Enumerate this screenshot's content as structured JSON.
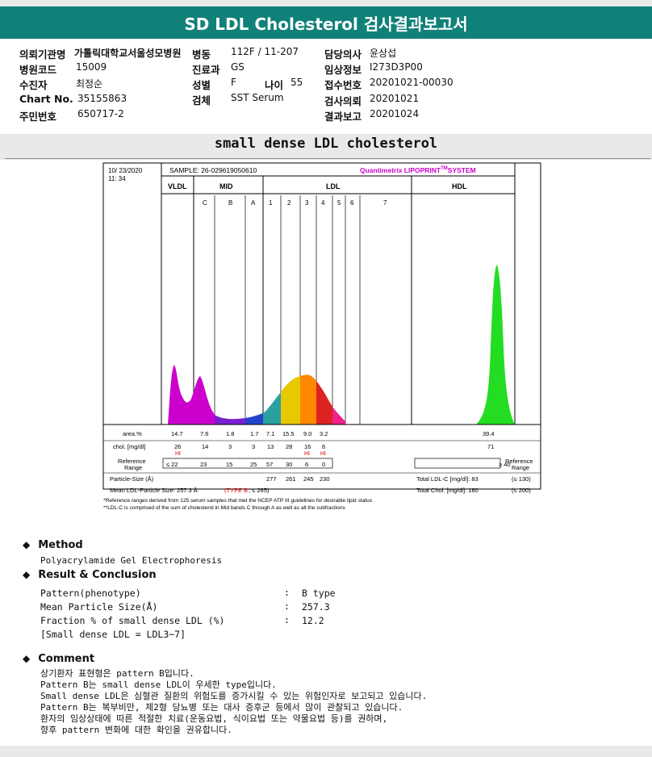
{
  "title": "SD LDL Cholesterol 검사결과보고서",
  "info": {
    "institution_label": "의뢰기관명",
    "institution_value": "가톨릭대학교서울성모병원",
    "ward_label": "병동",
    "ward_value": "112F / 11-207",
    "doctor_label": "담당의사",
    "doctor_value": "윤상섭",
    "hospital_code_label": "병원코드",
    "hospital_code_value": "15009",
    "dept_label": "진료과",
    "dept_value": "GS",
    "clinical_label": "임상정보",
    "clinical_value": "I273D3P00",
    "patient_label": "수진자",
    "patient_value": "최정순",
    "sex_label": "성별",
    "sex_value": "F",
    "age_label": "나이",
    "age_value": "55",
    "receipt_label": "접수번호",
    "receipt_value": "20201021-00030",
    "chart_label": "Chart No.",
    "chart_value": "35155863",
    "specimen_label": "검체",
    "specimen_value": "SST Serum",
    "request_label": "검사의뢰",
    "request_value": "20201021",
    "rrn_label": "주민번호",
    "rrn_value": "650717-2",
    "report_label": "결과보고",
    "report_value": "20201024"
  },
  "section_title": "small dense LDL cholesterol",
  "lipoprint": {
    "date": "10/ 23/2020",
    "time": "11: 34",
    "sample": "SAMPLE:   26-029619050610",
    "brand": "Quantimetrix LIPOPRINT",
    "brand_tm": "TM",
    "brand_system": "SYSTEM",
    "groups": [
      "VLDL",
      "MID",
      "LDL",
      "HDL"
    ],
    "bands": [
      "C",
      "B",
      "A",
      "1",
      "2",
      "3",
      "4",
      "5",
      "6",
      "7"
    ],
    "row_area_label": "area.%",
    "row_area": [
      "14.7",
      "7.6",
      "1.8",
      "1.7",
      "7.1",
      "15.5",
      "9.0",
      "3.2"
    ],
    "area_hdl": "39.4",
    "row_chol_label": "chol. [mg/dl]",
    "row_chol": [
      "26",
      "14",
      "3",
      "3",
      "13",
      "28",
      "16",
      "6"
    ],
    "chol_hdl": "71",
    "hi_flag": "HI",
    "ref_label_1": "Reference",
    "ref_label_2": "Range",
    "ref_values": [
      "≤ 22",
      "23",
      "15",
      "25",
      "57",
      "30",
      "6",
      "0"
    ],
    "ref_hdl": "≥ 40",
    "ref_right_1": "Reference",
    "ref_right_2": "Range",
    "particle_size_label": "Particle-Size (Å)",
    "particle_sizes": [
      "277",
      "261",
      "245",
      "230"
    ],
    "total_ldl_label": "Total LDL-C [mg/dl]: 83",
    "total_ldl_ref": "(≤ 130)",
    "mean_size_label": "Mean LDL-Particle Size:   257.3 Å",
    "mean_type": "(TYPE B",
    "mean_type_ref": "; ≤ 265)",
    "total_chol_label": "Total Chol. [mg/dl]:   180",
    "total_chol_ref": "(≤ 200)",
    "footnote1": "*Reference ranges derived from 125 serum samples that met the NCEP ATP III guidelines for desirable lipid status",
    "footnote2": "**LDL-C is comprised of the sum of cholesterol in Mid bands C through A as well as all the subfractions"
  },
  "method": {
    "heading": "Method",
    "text": "Polyacrylamide Gel Electrophoresis"
  },
  "result": {
    "heading": "Result & Conclusion",
    "rows": [
      {
        "label": "Pattern(phenotype)",
        "sep": ":",
        "value": "B type"
      },
      {
        "label": "Mean Particle Size(Å)",
        "sep": ":",
        "value": "257.3"
      },
      {
        "label": "Fraction % of small dense LDL (%)",
        "sep": ":",
        "value": "12.2"
      }
    ],
    "note": "[Small dense LDL = LDL3~7]"
  },
  "comment": {
    "heading": "Comment",
    "lines": [
      "상기환자 표현형은 pattern B입니다.",
      "Pattern B는 small dense LDL이 우세한 type입니다.",
      "Small dense LDL은 심혈관 질환의 위험도를 증가시킬 수 있는 위험인자로 보고되고 있습니다.",
      "Pattern B는 복부비만, 제2형 당뇨병 또는 대사 증후군 등에서 많이 관찰되고 있습니다.",
      "환자의 임상상태에 따른 적절한 치료(운동요법, 식이요법 또는 약물요법 등)를 권하며,",
      "향후 pattern 변화에 대한 확인을 권유합니다."
    ]
  },
  "colors": {
    "header": "#0f8178",
    "vldl": "#cc00cc",
    "hdl": "#22dd22",
    "hi": "#e00000",
    "brand": "#cc00cc"
  }
}
